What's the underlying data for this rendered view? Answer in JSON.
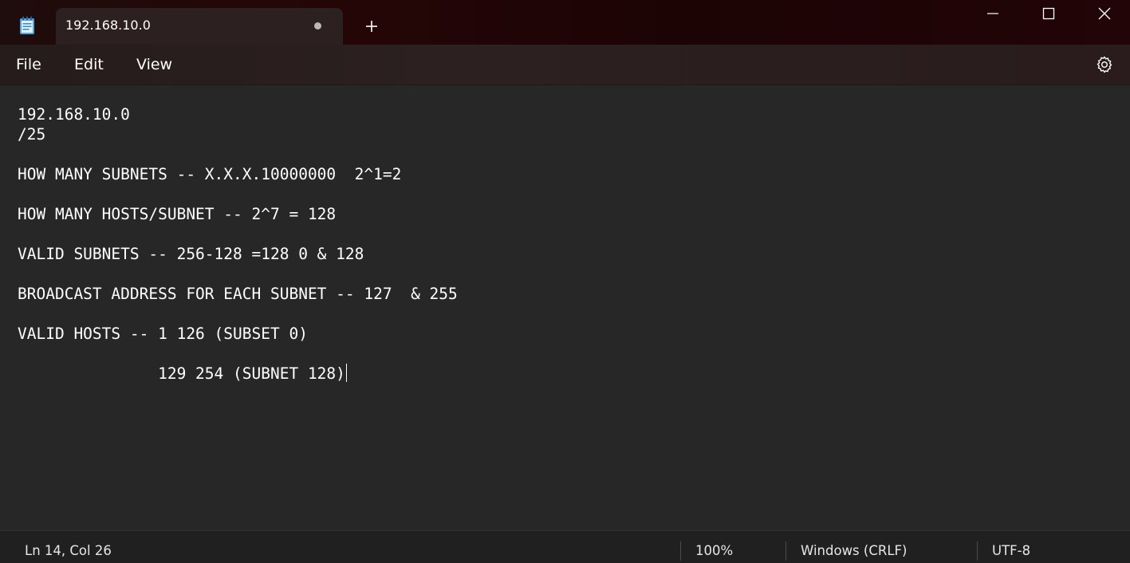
{
  "app": {
    "tab_title": "192.168.10.0",
    "app_icon": "notepad-icon",
    "tab_modified_indicator": "dot",
    "new_tab_icon": "plus-icon",
    "window_controls": [
      "minimize-icon",
      "maximize-icon",
      "close-icon"
    ]
  },
  "menu": {
    "file": "File",
    "edit": "Edit",
    "view": "View",
    "settings_icon": "gear-icon"
  },
  "editor": {
    "lines": [
      "192.168.10.0",
      "/25",
      "",
      "HOW MANY SUBNETS -- X.X.X.10000000  2^1=2",
      "",
      "HOW MANY HOSTS/SUBNET -- 2^7 = 128",
      "",
      "VALID SUBNETS -- 256-128 =128 0 & 128",
      "",
      "BROADCAST ADDRESS FOR EACH SUBNET -- 127  & 255",
      "",
      "VALID HOSTS -- 1 126 (SUBSET 0)",
      "",
      "               129 254 (SUBNET 128)"
    ]
  },
  "status": {
    "position": "Ln 14, Col 26",
    "zoom": "100%",
    "line_ending": "Windows (CRLF)",
    "encoding": "UTF-8"
  },
  "colors": {
    "background": "#272727",
    "titlebar": "#1f0c0c",
    "text": "#ffffff"
  }
}
